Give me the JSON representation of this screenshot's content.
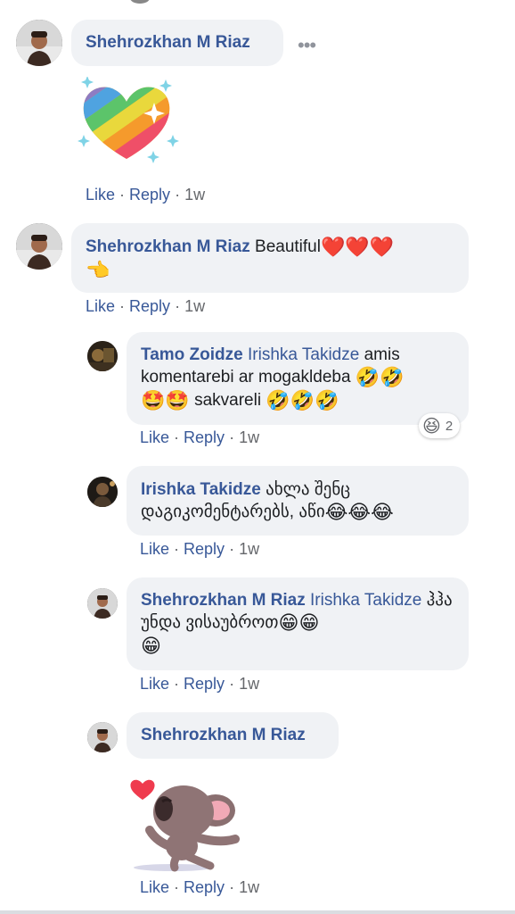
{
  "comments": [
    {
      "author": "Shehrozkhan M Riaz",
      "more": "•••",
      "actions": {
        "like": "Like",
        "reply": "Reply",
        "time": "1w"
      }
    },
    {
      "author": "Shehrozkhan M Riaz",
      "text": "Beautiful",
      "emoji1": "❤️❤️❤️",
      "emoji2": "👈",
      "actions": {
        "like": "Like",
        "reply": "Reply",
        "time": "1w"
      }
    }
  ],
  "replies": [
    {
      "author": "Tamo Zoidze",
      "mention": "Irishka Takidze",
      "text1": "amis komentarebi ar mogakldeba",
      "emoji1": "🤣🤣",
      "emoji2": "🤩🤩",
      "text2": "sakvareli",
      "emoji3": "🤣🤣🤣",
      "reaction_emoji": "😆",
      "reaction_count": "2",
      "actions": {
        "like": "Like",
        "reply": "Reply",
        "time": "1w"
      }
    },
    {
      "author": "Irishka Takidze",
      "text": "ახლა შენც დაგიკომენტარებს, აწი",
      "emoji": "😂😂😂",
      "actions": {
        "like": "Like",
        "reply": "Reply",
        "time": "1w"
      }
    },
    {
      "author": "Shehrozkhan M Riaz",
      "mention": "Irishka Takidze",
      "text": "ჰჰა უნდა ვისაუბროთ",
      "emoji1": "😁😁",
      "emoji2": "😁",
      "actions": {
        "like": "Like",
        "reply": "Reply",
        "time": "1w"
      }
    },
    {
      "author": "Shehrozkhan M Riaz",
      "actions": {
        "like": "Like",
        "reply": "Reply",
        "time": "1w"
      }
    }
  ],
  "colors": {
    "name": "#385898",
    "bubble": "#f0f2f5",
    "meta": "#65676b"
  }
}
